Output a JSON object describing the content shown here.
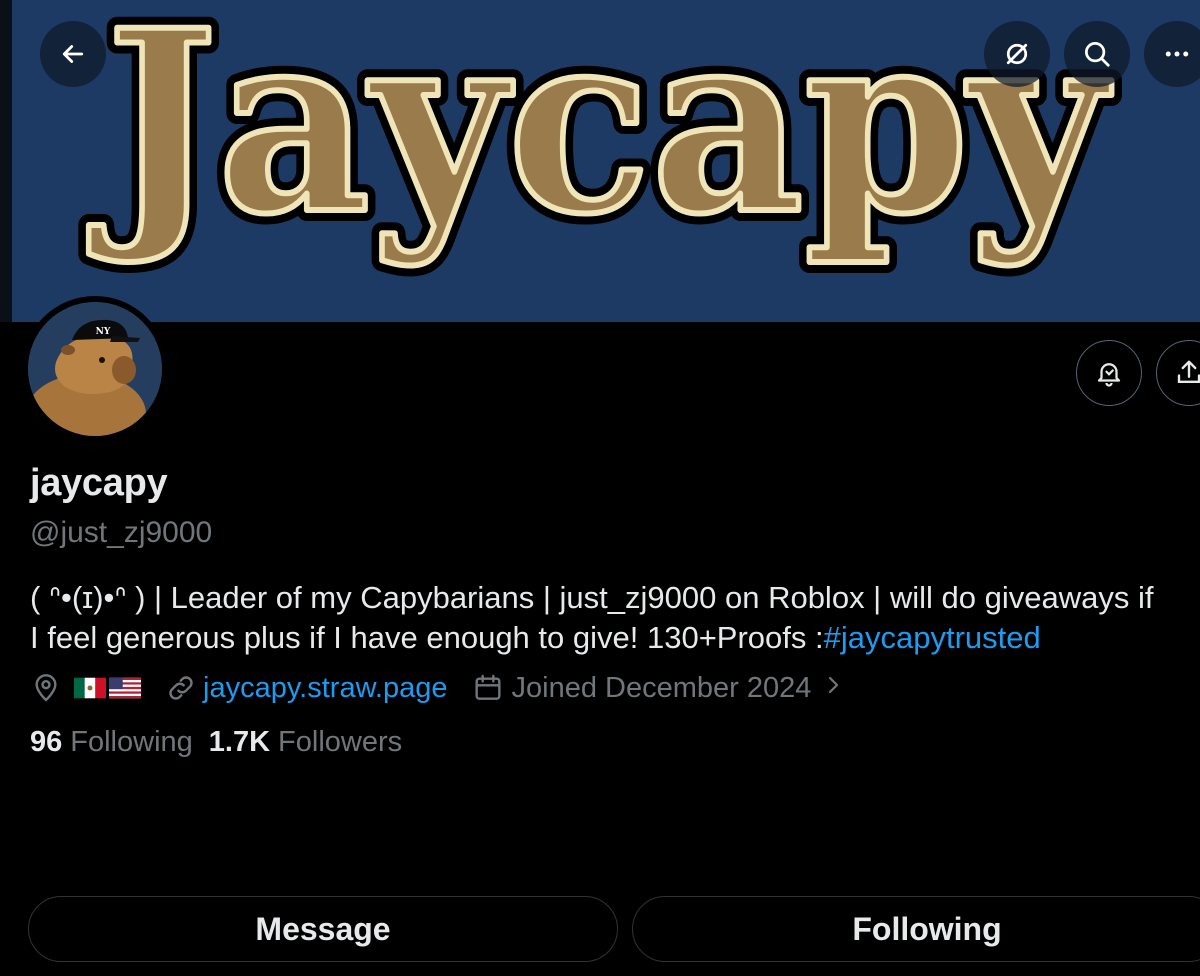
{
  "banner": {
    "logo_text": "Jaycapy",
    "colors": {
      "background": "#1c3a64",
      "letters": "#9a7c4c",
      "letter_outline": "#efe5b8"
    }
  },
  "top_nav": {
    "back_icon": "arrow-left-icon",
    "grok_icon": "slashed-circle-icon",
    "search_icon": "search-icon",
    "more_icon": "more-horizontal-icon"
  },
  "profile": {
    "avatar_icon": "capybara-avatar-icon",
    "avatar_cap_logo": "NY",
    "display_name": "jaycapy",
    "handle": "@just_zj9000",
    "bio_line_1": "( ᐢ•(ɪ)•ᐢ ) | Leader of my Capybarians | just_zj9000 on Roblox | will do giveaways if",
    "bio_line_2_prefix": "I feel generous plus if I have enough to give! 130+Proofs :",
    "bio_hashtag": "#jaycapytrusted",
    "location_icon": "location-pin-icon",
    "location_flags": [
      "mexico-flag-icon",
      "usa-flag-icon"
    ],
    "link_icon": "link-icon",
    "link_text": "jaycapy.straw.page",
    "joined_icon": "calendar-icon",
    "joined_text": "Joined December 2024"
  },
  "actions": {
    "notify_icon": "notification-bell-icon",
    "share_icon": "share-icon"
  },
  "stats": {
    "following_count": "96",
    "following_label": "Following",
    "followers_count": "1.7K",
    "followers_label": "Followers"
  },
  "buttons": {
    "message_label": "Message",
    "following_label": "Following"
  },
  "colors": {
    "accent": "#1d9bf0",
    "text_primary": "#e7e9ea",
    "text_secondary": "#71767b",
    "background": "#000000"
  }
}
